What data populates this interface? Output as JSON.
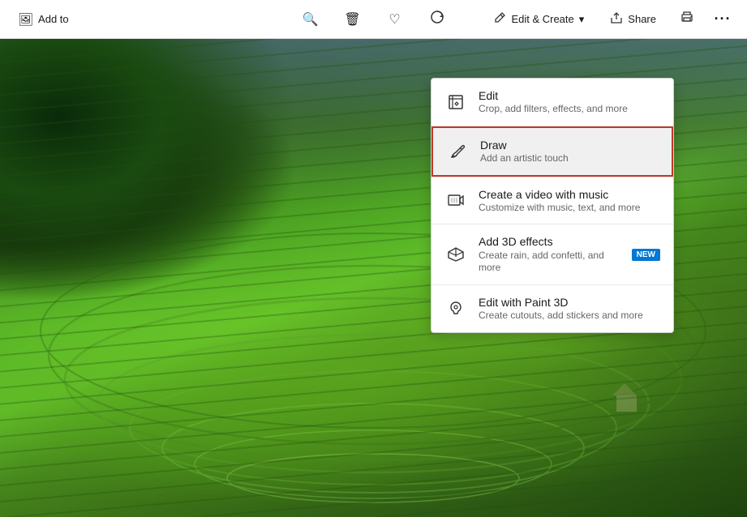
{
  "toolbar": {
    "add_to_label": "Add to",
    "zoom_icon": "🔍",
    "delete_icon": "🗑",
    "favorite_icon": "♡",
    "rotate_icon": "⟳",
    "edit_create_label": "Edit & Create",
    "share_label": "Share",
    "print_icon": "🖨",
    "more_icon": "..."
  },
  "menu": {
    "items": [
      {
        "id": "edit",
        "title": "Edit",
        "subtitle": "Crop, add filters, effects, and more",
        "icon": "edit",
        "selected": false,
        "has_badge": false
      },
      {
        "id": "draw",
        "title": "Draw",
        "subtitle": "Add an artistic touch",
        "icon": "draw",
        "selected": true,
        "has_badge": false
      },
      {
        "id": "video",
        "title": "Create a video with music",
        "subtitle": "Customize with music, text, and more",
        "icon": "video",
        "selected": false,
        "has_badge": false
      },
      {
        "id": "3d",
        "title": "Add 3D effects",
        "subtitle": "Create rain, add confetti, and more",
        "icon": "3d",
        "selected": false,
        "has_badge": true,
        "badge_text": "NEW"
      },
      {
        "id": "paint3d",
        "title": "Edit with Paint 3D",
        "subtitle": "Create cutouts, add stickers and more",
        "icon": "paint3d",
        "selected": false,
        "has_badge": false
      }
    ]
  }
}
